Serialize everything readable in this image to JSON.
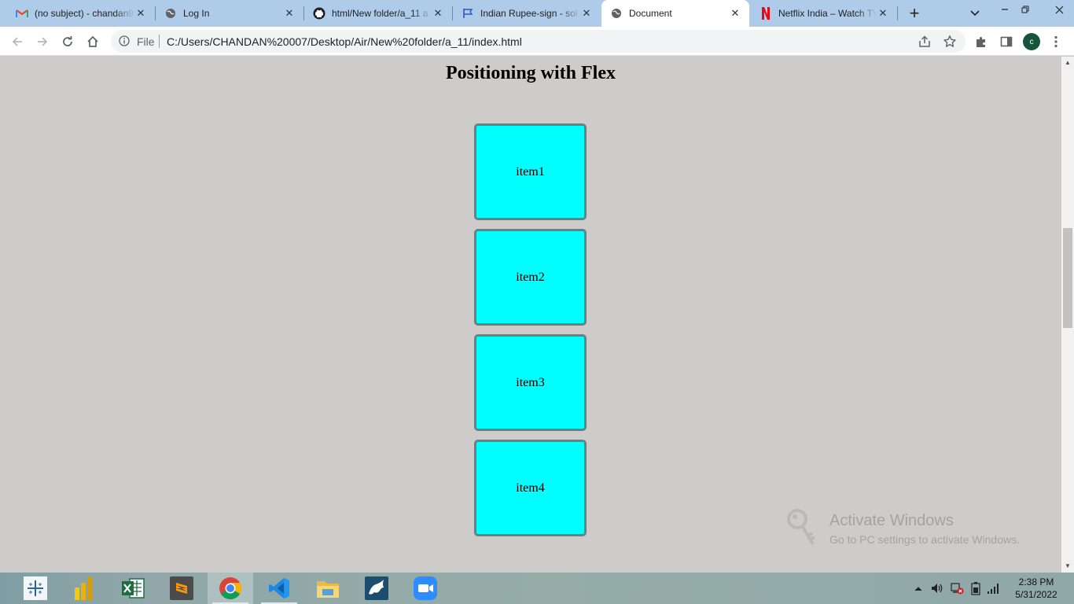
{
  "browser": {
    "tabs": [
      {
        "title": "(no subject) - chandan9",
        "icon": "gmail-icon",
        "active": false
      },
      {
        "title": "Log In",
        "icon": "globe-icon",
        "active": false
      },
      {
        "title": "html/New folder/a_11 a",
        "icon": "github-icon",
        "active": false
      },
      {
        "title": "Indian Rupee-sign - sol",
        "icon": "flag-icon",
        "active": false
      },
      {
        "title": "Document",
        "icon": "globe-icon",
        "active": true
      },
      {
        "title": "Netflix India – Watch TV",
        "icon": "netflix-icon",
        "active": false
      }
    ],
    "new_tab_label": "+",
    "address": {
      "scheme_label": "File",
      "url": "C:/Users/CHANDAN%20007/Desktop/Air/New%20folder/a_11/index.html"
    },
    "profile_initial": "c"
  },
  "page": {
    "heading": "Positioning with Flex",
    "items": [
      "item1",
      "item2",
      "item3",
      "item4"
    ],
    "colors": {
      "item_bg": "#00ffff",
      "item_border": "#6b7f82",
      "page_bg": "#cdcccb"
    }
  },
  "watermark": {
    "line1": "Activate Windows",
    "line2": "Go to PC settings to activate Windows."
  },
  "taskbar": {
    "apps": [
      "tableau-icon",
      "power-bi-icon",
      "excel-icon",
      "sublime-text-icon",
      "chrome-icon",
      "vscode-icon",
      "file-explorer-icon",
      "mysql-workbench-icon",
      "zoom-icon"
    ],
    "time": "2:38 PM",
    "date": "5/31/2022"
  }
}
